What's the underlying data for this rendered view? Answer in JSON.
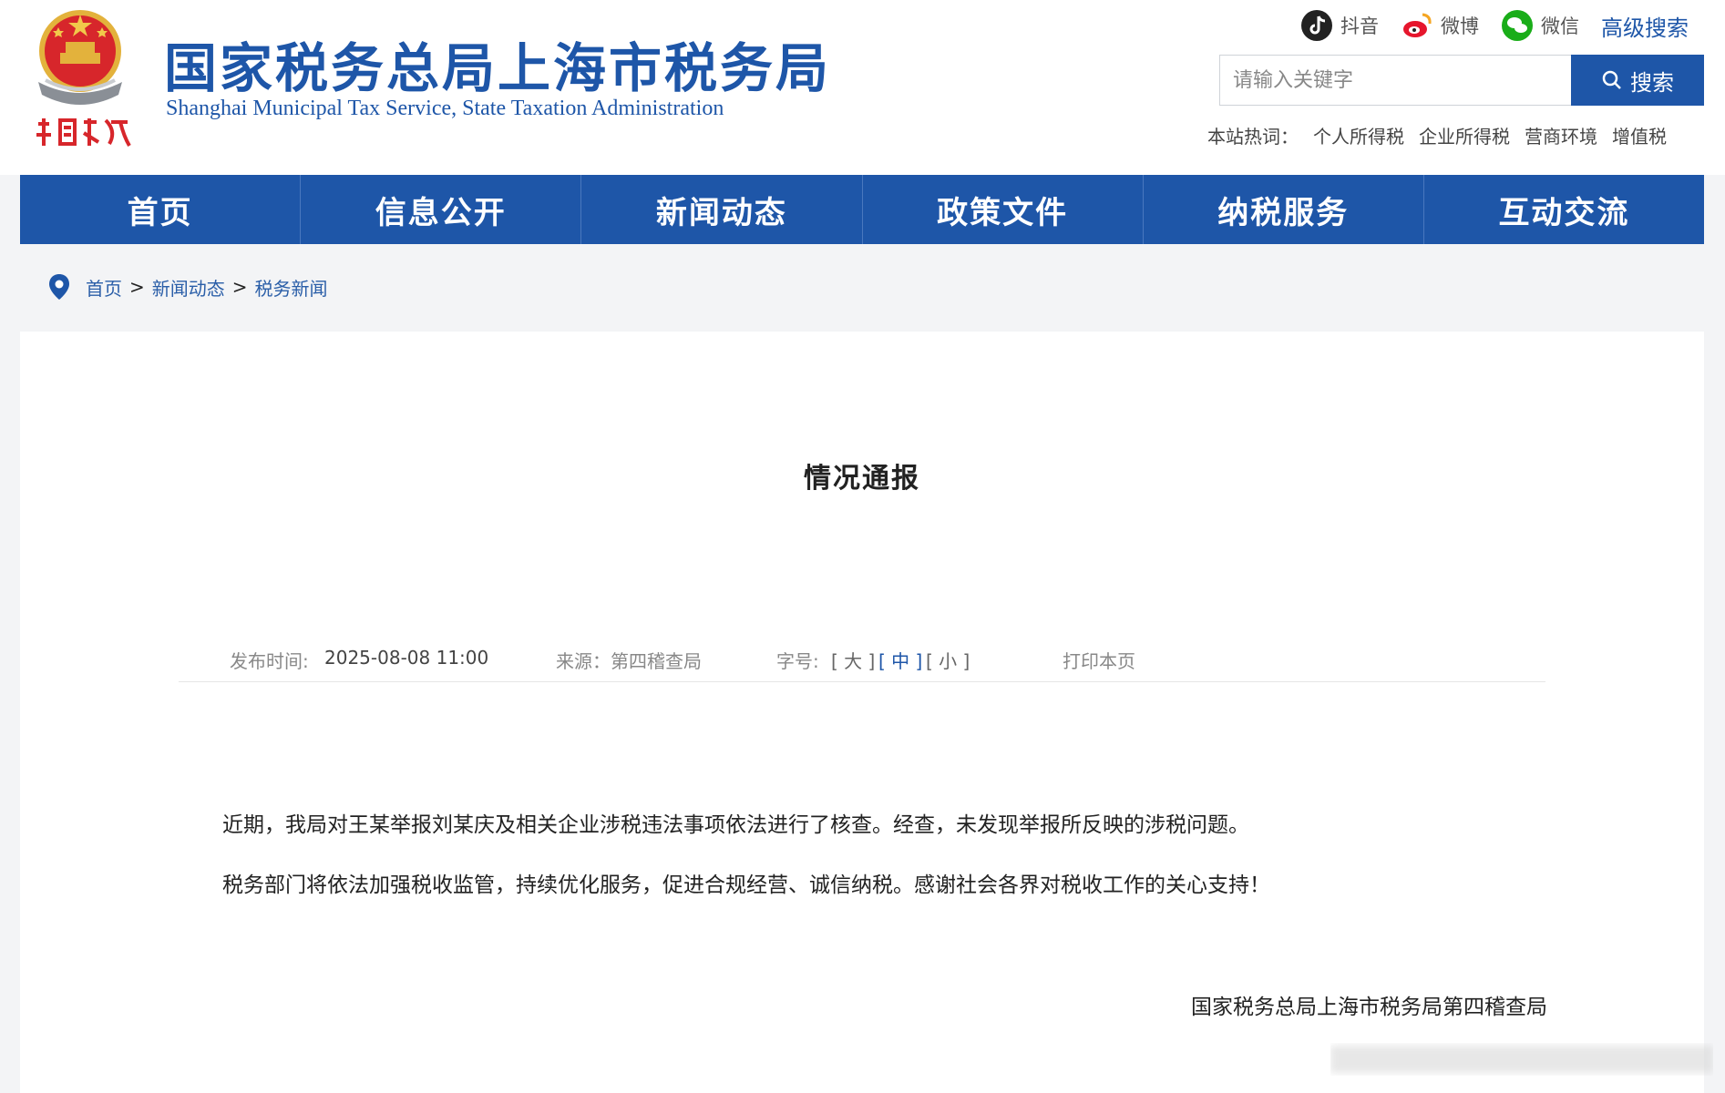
{
  "header": {
    "title_cn": "国家税务总局上海市税务局",
    "title_en": "Shanghai Municipal Tax Service, State Taxation Administration",
    "social": {
      "douyin": "抖音",
      "weibo": "微博",
      "wechat": "微信"
    },
    "advanced_search": "高级搜索",
    "search": {
      "placeholder": "请输入关键字",
      "button": "搜索"
    },
    "hotwords": {
      "label": "本站热词：",
      "items": [
        "个人所得税",
        "企业所得税",
        "营商环境",
        "增值税"
      ]
    },
    "brand_color": "#1e56a8"
  },
  "nav": {
    "items": [
      "首页",
      "信息公开",
      "新闻动态",
      "政策文件",
      "纳税服务",
      "互动交流"
    ]
  },
  "breadcrumb": {
    "items": [
      "首页",
      "新闻动态",
      "税务新闻"
    ],
    "separator": ">"
  },
  "article": {
    "title": "情况通报",
    "meta": {
      "date_label": "发布时间:",
      "date": "2025-08-08 11:00",
      "source": "来源：第四稽查局",
      "font_label": "字号:",
      "font_large": "[ 大 ]",
      "font_medium": "[ 中 ]",
      "font_small": "[ 小 ]",
      "print": "打印本页"
    },
    "paragraphs": [
      "近期，我局对王某举报刘某庆及相关企业涉税违法事项依法进行了核查。经查，未发现举报所反映的涉税问题。",
      "税务部门将依法加强税收监管，持续优化服务，促进合规经营、诚信纳税。感谢社会各界对税收工作的关心支持！"
    ],
    "signature": "国家税务总局上海市税务局第四稽查局"
  }
}
